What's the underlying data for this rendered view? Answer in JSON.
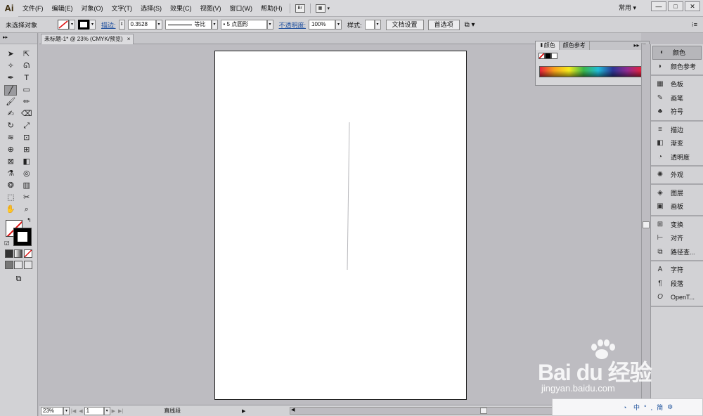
{
  "menubar": {
    "app_logo": "Ai",
    "items": [
      "文件(F)",
      "编辑(E)",
      "对象(O)",
      "文字(T)",
      "选择(S)",
      "效果(C)",
      "视图(V)",
      "窗口(W)",
      "帮助(H)"
    ],
    "bridge_label": "Br",
    "workspace": "常用",
    "window_controls": [
      "—",
      "□",
      "✕"
    ]
  },
  "controlbar": {
    "selection_status": "未选择对象",
    "stroke_label": "描边:",
    "stroke_weight": "0.3528",
    "stroke_profile": "等比",
    "brush_label": "5 点圆形",
    "opacity_label": "不透明度:",
    "opacity_value": "100%",
    "style_label": "样式:",
    "doc_setup_button": "文档设置",
    "prefs_button": "首选项"
  },
  "document_tab": {
    "title": "未标题-1* @ 23% (CMYK/预览)",
    "close": "×"
  },
  "color_panel": {
    "tabs": [
      "颜色",
      "颜色参考"
    ]
  },
  "dock": {
    "groups": [
      [
        {
          "label": "颜色",
          "icon": "palette-icon",
          "glyph": "◐",
          "active": true
        },
        {
          "label": "颜色参考",
          "icon": "color-guide-icon",
          "glyph": "◗",
          "active": false
        }
      ],
      [
        {
          "label": "色板",
          "icon": "swatches-icon",
          "glyph": "▦",
          "active": false
        },
        {
          "label": "画笔",
          "icon": "brush-icon",
          "glyph": "✎",
          "active": false
        },
        {
          "label": "符号",
          "icon": "symbol-icon",
          "glyph": "♣",
          "active": false
        }
      ],
      [
        {
          "label": "描边",
          "icon": "stroke-icon",
          "glyph": "≡",
          "active": false
        },
        {
          "label": "渐变",
          "icon": "gradient-icon",
          "glyph": "◧",
          "active": false
        },
        {
          "label": "透明度",
          "icon": "transparency-icon",
          "glyph": "◔",
          "active": false
        }
      ],
      [
        {
          "label": "外观",
          "icon": "appearance-icon",
          "glyph": "✺",
          "active": false
        }
      ],
      [
        {
          "label": "图层",
          "icon": "layers-icon",
          "glyph": "◈",
          "active": false
        },
        {
          "label": "画板",
          "icon": "artboards-icon",
          "glyph": "▣",
          "active": false
        }
      ],
      [
        {
          "label": "变换",
          "icon": "transform-icon",
          "glyph": "⊞",
          "active": false
        },
        {
          "label": "对齐",
          "icon": "align-icon",
          "glyph": "⊢",
          "active": false
        },
        {
          "label": "路径查...",
          "icon": "pathfinder-icon",
          "glyph": "⧉",
          "active": false
        }
      ],
      [
        {
          "label": "字符",
          "icon": "character-icon",
          "glyph": "A",
          "active": false
        },
        {
          "label": "段落",
          "icon": "paragraph-icon",
          "glyph": "¶",
          "active": false
        },
        {
          "label": "OpenT...",
          "icon": "opentype-icon",
          "glyph": "O",
          "active": false
        }
      ]
    ]
  },
  "statusbar": {
    "zoom": "23%",
    "artboard_number": "1",
    "current_tool": "直线段"
  },
  "watermark": {
    "brand": "Bai du 经验",
    "url": "jingyan.baidu.com"
  },
  "ime": {
    "items": [
      "中",
      "°",
      ",",
      "简",
      "⚙"
    ]
  }
}
